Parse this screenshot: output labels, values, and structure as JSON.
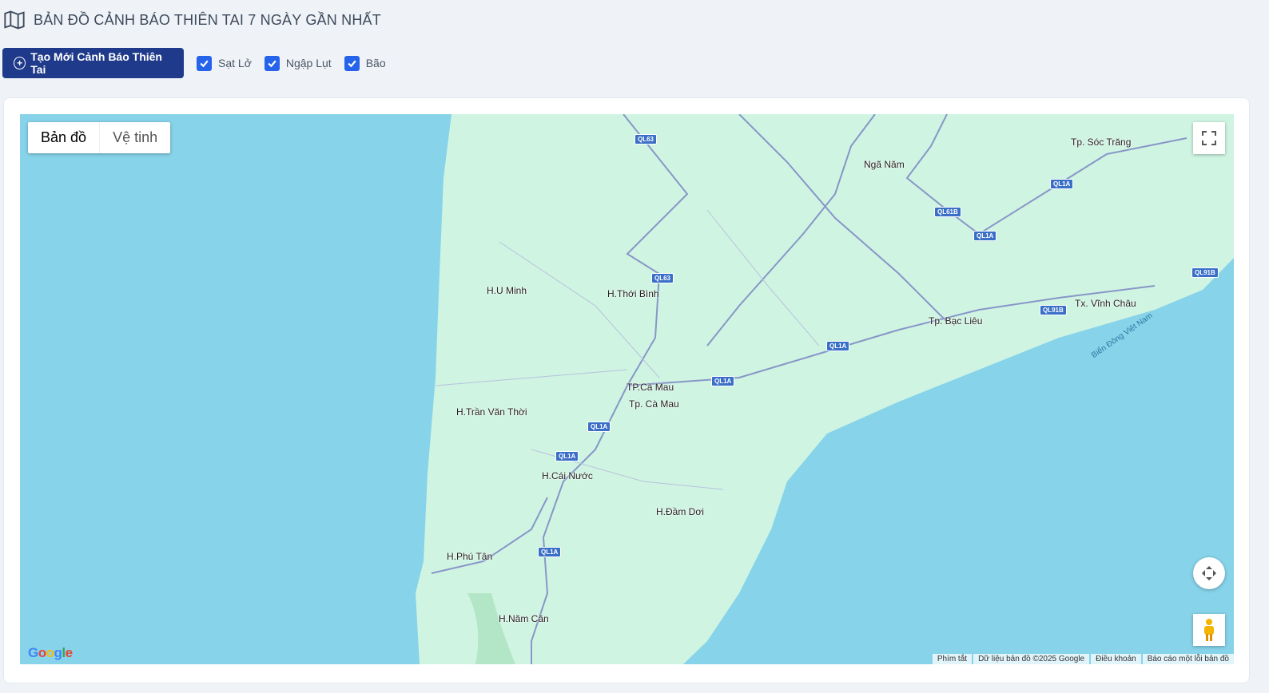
{
  "header": {
    "title": "BẢN ĐỒ CẢNH BÁO THIÊN TAI 7 NGÀY GẦN NHẤT",
    "icon": "map-icon"
  },
  "toolbar": {
    "create_label": "Tạo Mới Cảnh Báo Thiên Tai",
    "filters": [
      {
        "label": "Sạt Lở",
        "checked": true
      },
      {
        "label": "Ngập Lụt",
        "checked": true
      },
      {
        "label": "Bão",
        "checked": true
      }
    ]
  },
  "map": {
    "type_buttons": [
      "Bản đồ",
      "Vệ tinh"
    ],
    "selected_type": "Bản đồ",
    "place_labels": [
      "H.U Minh",
      "H.Thới Bình",
      "TP.Cà Mau",
      "Tp. Cà Mau",
      "H.Trần Văn Thời",
      "H.Cái Nước",
      "H.Đầm Dơi",
      "H.Phú Tân",
      "H.Năm Căn",
      "Ngã Năm",
      "Tp. Sóc Trăng",
      "Tp. Bạc Liêu",
      "Tx. Vĩnh Châu",
      "Biển Đông Việt Nam"
    ],
    "road_shields": [
      "QL63",
      "QL63",
      "QL1A",
      "QL1A",
      "QL1A",
      "QL1A",
      "QL1A",
      "QL1A",
      "QL1A",
      "QL61B",
      "QL91B",
      "QL91B"
    ],
    "footer": [
      "Phím tắt",
      "Dữ liệu bản đồ ©2025 Google",
      "Điều khoản",
      "Báo cáo một lỗi bản đồ"
    ],
    "logo": "Google"
  }
}
